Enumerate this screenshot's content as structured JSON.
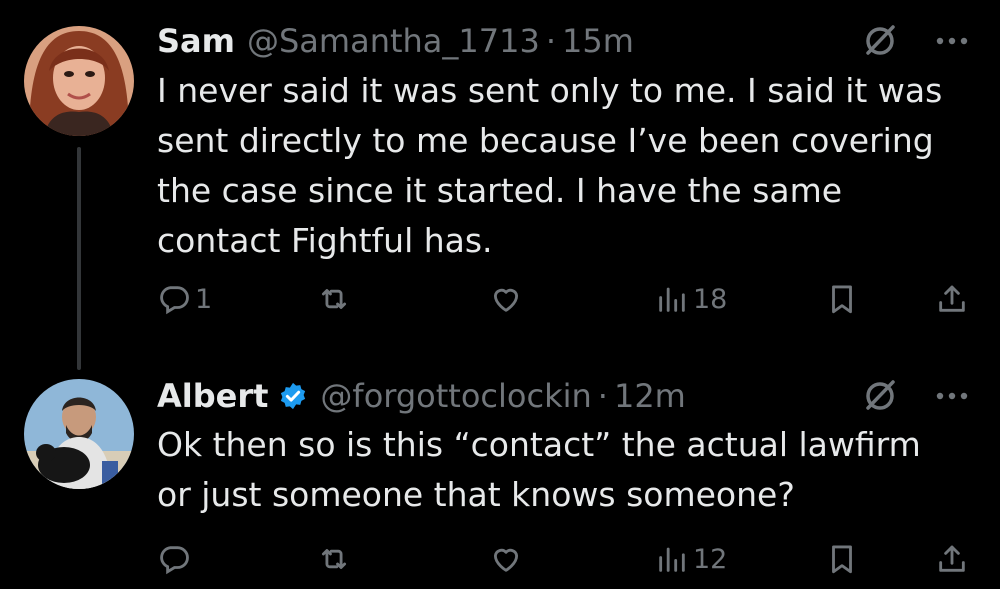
{
  "tweets": [
    {
      "name": "Sam",
      "handle": "@Samantha_1713",
      "separator": "·",
      "time": "15m",
      "verified": false,
      "avatar": "avatar-woman-photo",
      "text": "I never said it was sent only to me. I said it was sent directly to me because I’ve been covering the case since it started. I have the same contact Fightful has.",
      "actions": {
        "replies": "1",
        "reposts": "",
        "likes": "",
        "views": "18"
      }
    },
    {
      "name": "Albert",
      "handle": "@forgottoclockin",
      "separator": "·",
      "time": "12m",
      "verified": true,
      "avatar": "avatar-man-with-dog-photo",
      "text": "Ok then so is this “contact” the actual lawfirm or just someone that knows someone?",
      "actions": {
        "replies": "",
        "reposts": "",
        "likes": "",
        "views": "12"
      }
    }
  ],
  "icons": {
    "reply": "reply-icon",
    "repost": "repost-icon",
    "like": "heart-icon",
    "views": "views-icon",
    "bookmark": "bookmark-icon",
    "share": "share-icon",
    "grok": "grok-icon",
    "more": "more-icon",
    "verified": "verified-badge-icon"
  },
  "colors": {
    "background": "#000000",
    "text": "#e7e9ea",
    "secondary": "#71767b",
    "verified": "#1d9bf0",
    "thread_line": "#333639"
  }
}
